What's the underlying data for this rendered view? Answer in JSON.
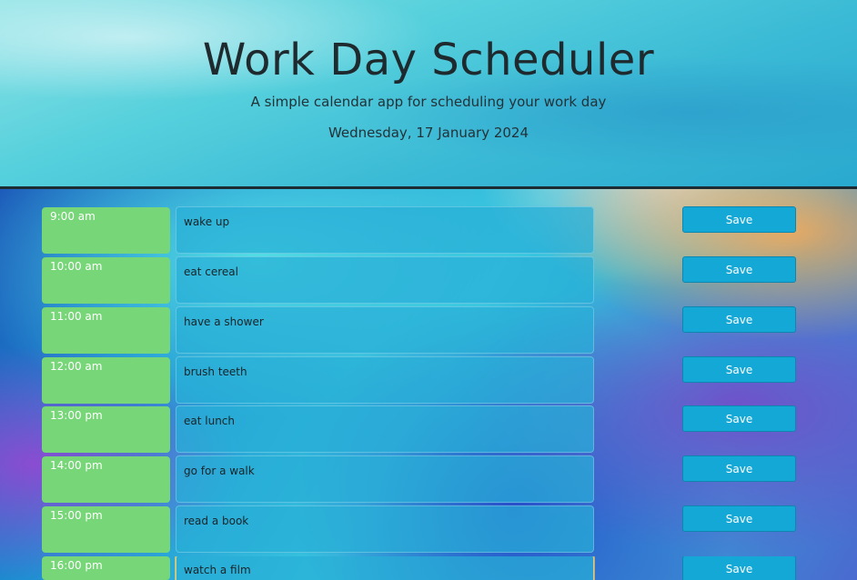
{
  "header": {
    "title": "Work Day Scheduler",
    "subtitle": "A simple calendar app for scheduling your work day",
    "date": "Wednesday, 17 January 2024"
  },
  "rows": [
    {
      "hour": "9:00 am",
      "task": "wake up",
      "save_label": "Save"
    },
    {
      "hour": "10:00 am",
      "task": "eat cereal",
      "save_label": "Save"
    },
    {
      "hour": "11:00 am",
      "task": "have a shower",
      "save_label": "Save"
    },
    {
      "hour": "12:00 am",
      "task": "brush teeth",
      "save_label": "Save"
    },
    {
      "hour": "13:00 pm",
      "task": "eat lunch",
      "save_label": "Save"
    },
    {
      "hour": "14:00 pm",
      "task": "go for a walk",
      "save_label": "Save"
    },
    {
      "hour": "15:00 pm",
      "task": "read a book",
      "save_label": "Save"
    },
    {
      "hour": "16:00 pm",
      "task": "watch a film",
      "save_label": "Save"
    }
  ],
  "colors": {
    "hour_block": "#77d677",
    "task_block": "#28afd7",
    "save_button": "#14a8d6",
    "header_border": "#1d2b33"
  }
}
